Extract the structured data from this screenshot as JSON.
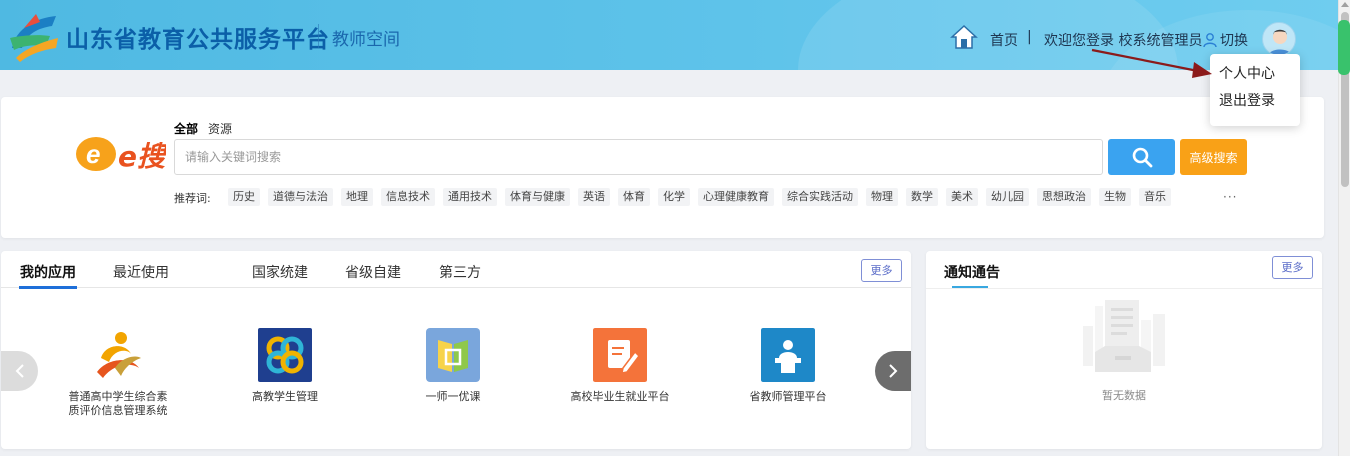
{
  "header": {
    "title": "山东省教育公共服务平台",
    "subtitle": "教师空间",
    "nav_home": "首页",
    "nav_separator": "|",
    "welcome": "欢迎您登录  校系统管理员",
    "switch_label": "切换",
    "colors": {
      "bg": "#5ec3ea",
      "title": "#0b5fa8"
    }
  },
  "user_menu": {
    "items": [
      "个人中心",
      "退出登录"
    ]
  },
  "search": {
    "tabs": [
      "全部",
      "资源"
    ],
    "active_tab": "全部",
    "placeholder": "请输入关键词搜索",
    "value": "",
    "advanced_label": "高级搜索",
    "recommend_label": "推荐词:",
    "tags": [
      "历史",
      "道德与法治",
      "地理",
      "信息技术",
      "通用技术",
      "体育与健康",
      "英语",
      "体育",
      "化学",
      "心理健康教育",
      "综合实践活动",
      "物理",
      "数学",
      "美术",
      "幼儿园",
      "思想政治",
      "生物",
      "音乐"
    ],
    "more": "···",
    "logo_text": "e搜"
  },
  "apps": {
    "tabs": [
      "我的应用",
      "最近使用",
      "国家统建",
      "省级自建",
      "第三方"
    ],
    "active_tab": "我的应用",
    "more_label": "更多",
    "items": [
      {
        "name": "普通高中学生综合素质评价信息管理系统",
        "line1": "普通高中学生综合素",
        "line2": "质评价信息管理系统",
        "icon": "swirl-logo-icon"
      },
      {
        "name": "高教学生管理",
        "icon": "rings-icon",
        "color": "#f0b300"
      },
      {
        "name": "一师一优课",
        "icon": "book-icon",
        "color": "#6aa0d8"
      },
      {
        "name": "高校毕业生就业平台",
        "icon": "edit-doc-icon",
        "color": "#f4733a"
      },
      {
        "name": "省教师管理平台",
        "icon": "teacher-podium-icon",
        "color": "#1e88c8"
      }
    ]
  },
  "notice": {
    "title": "通知通告",
    "more_label": "更多",
    "empty_text": "暂无数据"
  }
}
